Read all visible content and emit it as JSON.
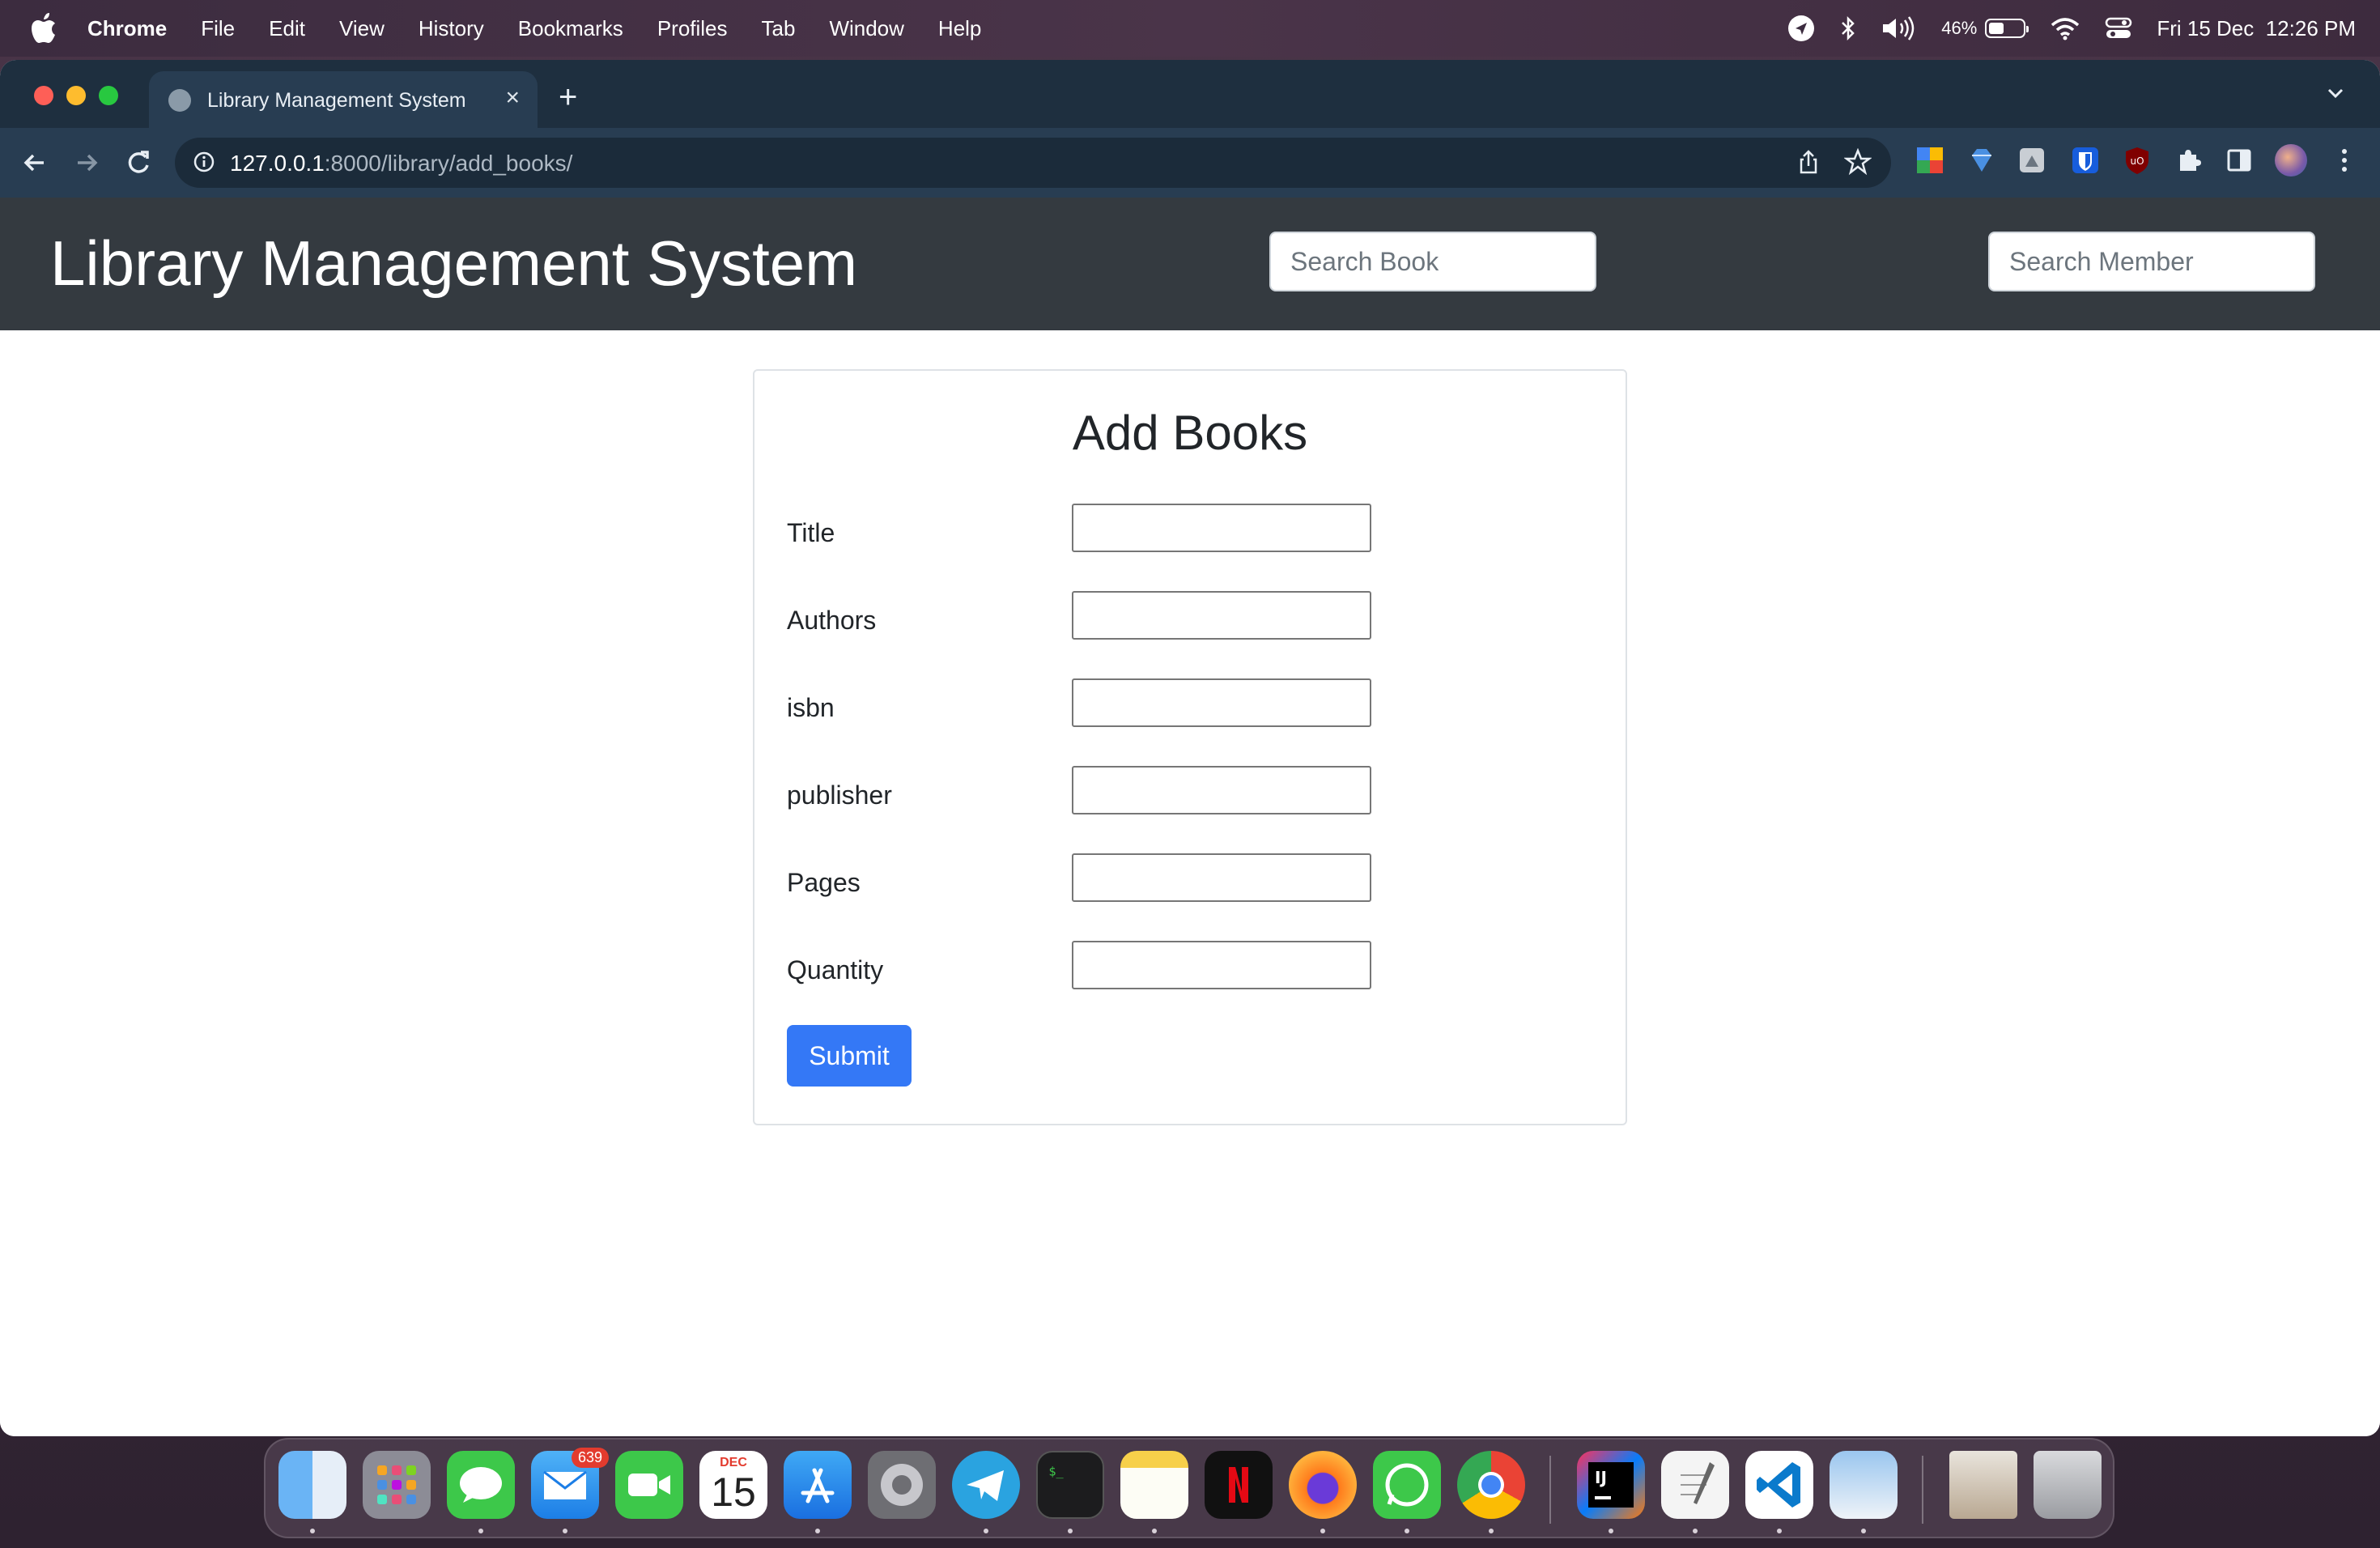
{
  "menubar": {
    "app_name": "Chrome",
    "menus": [
      "File",
      "Edit",
      "View",
      "History",
      "Bookmarks",
      "Profiles",
      "Tab",
      "Window",
      "Help"
    ],
    "battery_percent": "46%",
    "battery_level": 0.46,
    "datetime": "Fri 15 Dec  12:26 PM"
  },
  "browser": {
    "tab_title": "Library Management System",
    "url_host": "127.0.0.1",
    "url_path": ":8000/library/add_books/"
  },
  "page": {
    "brand": "Library Management System",
    "search_book_placeholder": "Search Book",
    "search_member_placeholder": "Search Member",
    "form_title": "Add Books",
    "fields": [
      {
        "label": "Title",
        "value": ""
      },
      {
        "label": "Authors",
        "value": ""
      },
      {
        "label": "isbn",
        "value": ""
      },
      {
        "label": "publisher",
        "value": ""
      },
      {
        "label": "Pages",
        "value": ""
      },
      {
        "label": "Quantity",
        "value": ""
      }
    ],
    "submit_label": "Submit"
  },
  "dock": {
    "mail_badge": "639",
    "calendar_month": "DEC",
    "calendar_day": "15",
    "apps": [
      "finder-icon",
      "launchpad-icon",
      "messages-icon",
      "mail-icon",
      "facetime-icon",
      "calendar-icon",
      "app-store-icon",
      "system-settings-icon",
      "telegram-icon",
      "terminal-icon",
      "notes-icon",
      "netflix-icon",
      "firefox-icon",
      "whatsapp-icon",
      "chrome-icon",
      "intellij-icon",
      "textedit-icon",
      "vscode-icon",
      "preview-icon",
      "downloads-stack-icon",
      "trash-icon"
    ]
  },
  "colors": {
    "navbar_bg": "#343a40",
    "submit_bg": "#3478f6",
    "tabstrip_bg": "#1e2f3f",
    "toolbar_bg": "#283d52"
  }
}
